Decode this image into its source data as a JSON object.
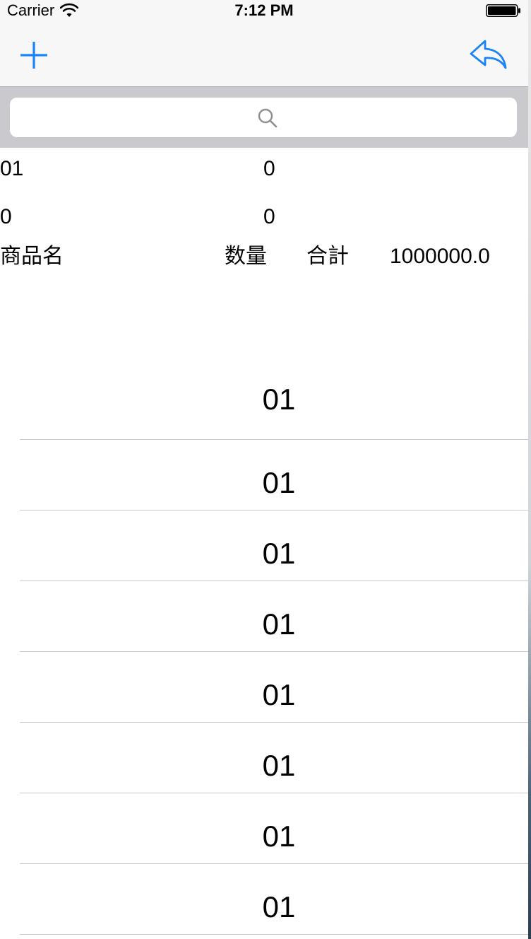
{
  "status_bar": {
    "carrier": "Carrier",
    "time": "7:12 PM"
  },
  "nav_bar": {
    "left_icon": "plus-icon",
    "right_icon": "reply-icon",
    "accent_color": "#1a82fb"
  },
  "search": {
    "placeholder": "",
    "icon": "search-icon"
  },
  "info": {
    "row1": {
      "left": "01",
      "right": "0"
    },
    "row2": {
      "left": "0",
      "right": "0"
    },
    "header": {
      "name_label": "商品名",
      "quantity_label": "数量",
      "total_label": "合計",
      "total_value": "1000000.0"
    }
  },
  "list": {
    "items": [
      {
        "label": "01"
      },
      {
        "label": "01"
      },
      {
        "label": "01"
      },
      {
        "label": "01"
      },
      {
        "label": "01"
      },
      {
        "label": "01"
      },
      {
        "label": "01"
      },
      {
        "label": "01"
      }
    ]
  }
}
